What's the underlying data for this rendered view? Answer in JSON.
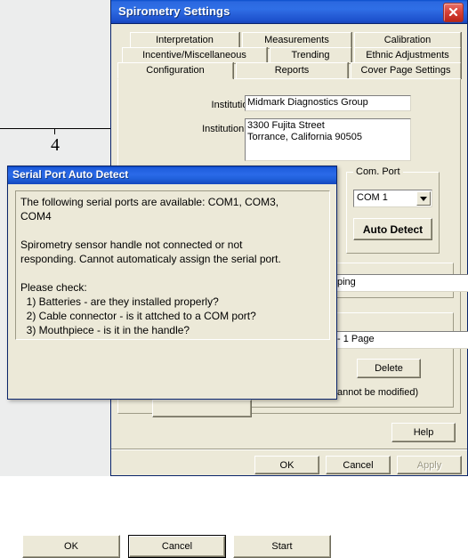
{
  "background": {
    "axis_tick_label": "4"
  },
  "settings_window": {
    "title": "Spirometry Settings",
    "close_icon": "close-icon",
    "tabs": [
      {
        "label": "Interpretation",
        "active": false
      },
      {
        "label": "Measurements",
        "active": false
      },
      {
        "label": "Calibration",
        "active": false
      },
      {
        "label": "Incentive/Miscellaneous",
        "active": false
      },
      {
        "label": "Trending",
        "active": false
      },
      {
        "label": "Ethnic Adjustments",
        "active": false
      },
      {
        "label": "Configuration",
        "active": true
      },
      {
        "label": "Reports",
        "active": false
      },
      {
        "label": "Cover Page Settings",
        "active": false
      }
    ],
    "fields": {
      "institution_name_label": "Institution Name",
      "institution_name_value": "Midmark Diagnostics Group",
      "institution_address_label": "Institution Address",
      "institution_address_line1": "3300 Fujita Street",
      "institution_address_line2": "Torrance, California 90505"
    },
    "com_port_group": {
      "title": "Com. Port",
      "combo_value": "COM 1",
      "auto_detect_label": "Auto Detect"
    },
    "partial_group_middle": {
      "combo_value": "ping"
    },
    "partial_group_lower": {
      "combo_value": "- 1 Page",
      "delete_label": "Delete",
      "note": "annot be modified)"
    },
    "help_label": "Help",
    "footer": {
      "ok_label": "OK",
      "cancel_label": "Cancel",
      "apply_label": "Apply",
      "apply_disabled": true
    }
  },
  "dialog": {
    "title": "Serial Port Auto Detect",
    "message_lines": [
      "The following serial ports are available: COM1, COM3,",
      "COM4",
      "",
      "Spirometry sensor handle not connected or not",
      "responding. Cannot automaticaly assign the serial port.",
      "",
      "Please check:",
      "  1) Batteries - are they installed properly?",
      "  2) Cable connector - is it attched to a COM port?",
      "  3) Mouthpiece - is it in the handle?"
    ],
    "buttons": {
      "ok_label": "OK",
      "cancel_label": "Cancel",
      "start_label": "Start",
      "default_button": "Cancel"
    }
  },
  "colors": {
    "window_face": "#ece9d8",
    "titlebar_blue": "#2a6ae8",
    "titlebar_border": "#0a246a",
    "close_red": "#d8433a",
    "disabled_text": "#9d9a86",
    "chart_background": "#eceded"
  }
}
